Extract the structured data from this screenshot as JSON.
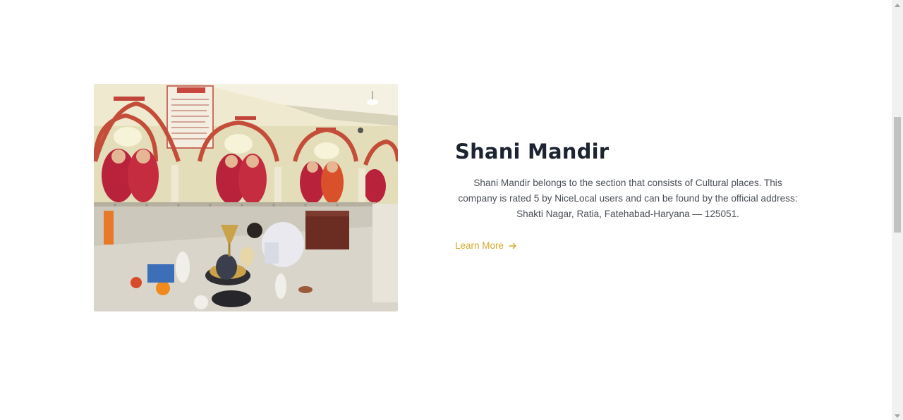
{
  "card": {
    "title": "Shani Mandir",
    "description": "Shani Mandir belongs to the section that consists of Cultural places. This company is rated 5 by NiceLocal users and can be found by the official address: Shakti Nagar, Ratia, Fatehabad-Haryana — 125051.",
    "learn_more_label": "Learn More",
    "accent_color": "#d4a72c",
    "title_color": "#1b2430"
  },
  "icons": {
    "learn_more": "arrow-right-icon",
    "scroll_up": "triangle-up-icon",
    "scroll_down": "triangle-down-icon"
  }
}
